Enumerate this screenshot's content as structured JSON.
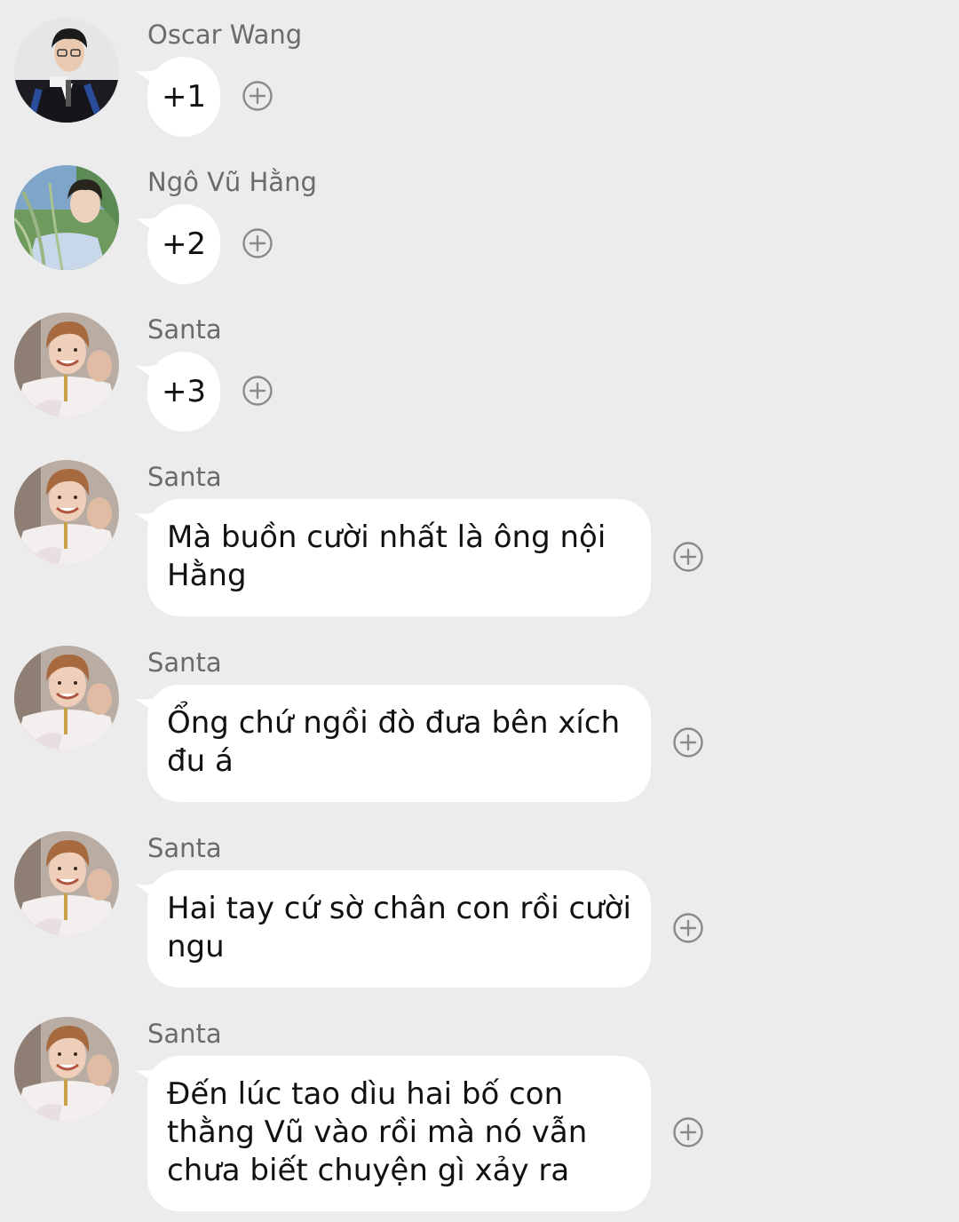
{
  "colors": {
    "background": "#ececec",
    "bubble": "#ffffff",
    "sender_text": "#6b6b6b",
    "message_text": "#111111",
    "react_icon": "#8a8a8a"
  },
  "messages": [
    {
      "sender": "Oscar Wang",
      "text": "+1",
      "avatar": "oscar-avatar",
      "react_icon": "add-reaction-icon"
    },
    {
      "sender": "Ngô Vũ Hằng",
      "text": "+2",
      "avatar": "hang-avatar",
      "react_icon": "add-reaction-icon"
    },
    {
      "sender": "Santa",
      "text": "+3",
      "avatar": "santa-avatar",
      "react_icon": "add-reaction-icon"
    },
    {
      "sender": "Santa",
      "text": "Mà buồn cười nhất là ông nội Hằng",
      "avatar": "santa-avatar",
      "react_icon": "add-reaction-icon"
    },
    {
      "sender": "Santa",
      "text": "Ổng chứ ngồi đò đưa bên xích đu á",
      "avatar": "santa-avatar",
      "react_icon": "add-reaction-icon"
    },
    {
      "sender": "Santa",
      "text": "Hai tay cứ sờ chân con rồi cười ngu",
      "avatar": "santa-avatar",
      "react_icon": "add-reaction-icon"
    },
    {
      "sender": "Santa",
      "text": "Đến lúc tao dìu hai bố con thằng Vũ vào rồi mà nó vẫn chưa biết chuyện gì xảy ra",
      "avatar": "santa-avatar",
      "react_icon": "add-reaction-icon"
    }
  ]
}
